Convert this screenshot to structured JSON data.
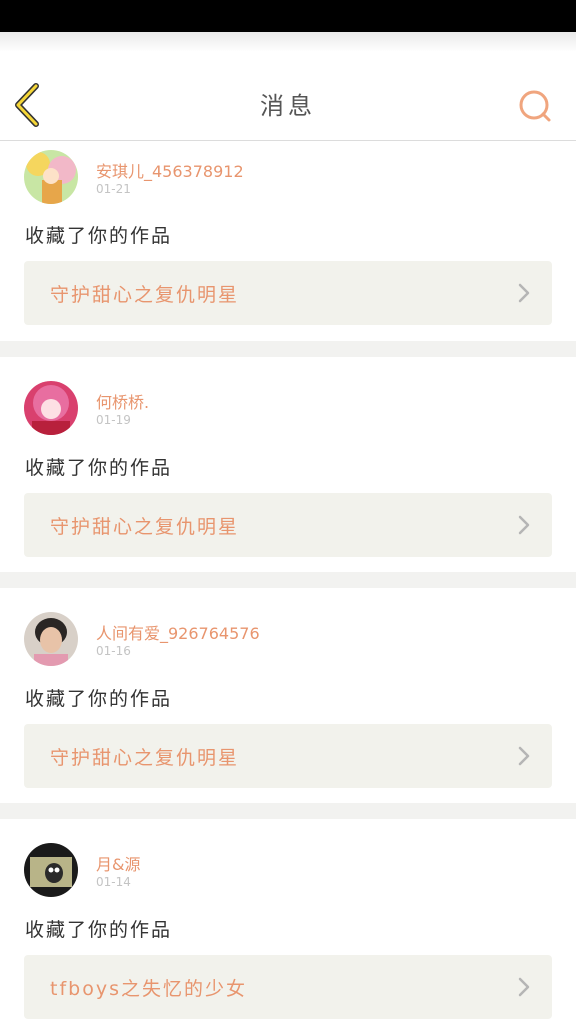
{
  "header": {
    "title": "消息",
    "back_icon": "chevron-left-icon",
    "search_icon": "search-icon",
    "accent_color": "#e8956e",
    "back_color": "#f5d638"
  },
  "messages": [
    {
      "user": "安琪儿_456378912",
      "date": "01-21",
      "action": "收藏了你的作品",
      "work": "守护甜心之复仇明星"
    },
    {
      "user": "何桥桥.",
      "date": "01-19",
      "action": "收藏了你的作品",
      "work": "守护甜心之复仇明星"
    },
    {
      "user": "人间有爱_926764576",
      "date": "01-16",
      "action": "收藏了你的作品",
      "work": "守护甜心之复仇明星"
    },
    {
      "user": "月&源",
      "date": "01-14",
      "action": "收藏了你的作品",
      "work": "tfboys之失忆的少女"
    }
  ]
}
